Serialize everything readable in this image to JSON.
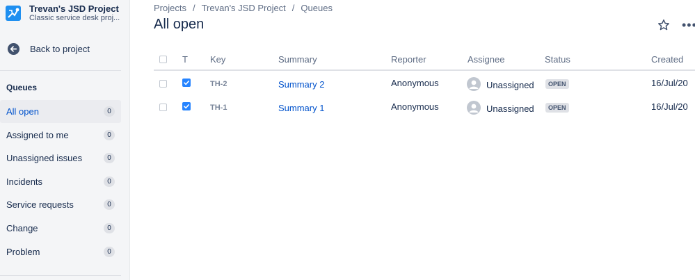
{
  "project": {
    "name": "Trevan's JSD Project",
    "type": "Classic service desk proj..."
  },
  "sidebar": {
    "back_label": "Back to project",
    "queues_heading": "Queues",
    "queues": [
      {
        "label": "All open",
        "count": "0",
        "active": true
      },
      {
        "label": "Assigned to me",
        "count": "0"
      },
      {
        "label": "Unassigned issues",
        "count": "0"
      },
      {
        "label": "Incidents",
        "count": "0"
      },
      {
        "label": "Service requests",
        "count": "0"
      },
      {
        "label": "Change",
        "count": "0"
      },
      {
        "label": "Problem",
        "count": "0"
      }
    ]
  },
  "breadcrumb": {
    "items": [
      "Projects",
      "Trevan's JSD Project",
      "Queues"
    ],
    "separator": "/"
  },
  "page": {
    "title": "All open",
    "more_label": "•••"
  },
  "table": {
    "columns": [
      "T",
      "Key",
      "Summary",
      "Reporter",
      "Assignee",
      "Status",
      "Created"
    ],
    "rows": [
      {
        "key": "TH-2",
        "summary": "Summary 2",
        "reporter": "Anonymous",
        "assignee": "Unassigned",
        "status": "OPEN",
        "created": "16/Jul/20"
      },
      {
        "key": "TH-1",
        "summary": "Summary 1",
        "reporter": "Anonymous",
        "assignee": "Unassigned",
        "status": "OPEN",
        "created": "16/Jul/20"
      }
    ]
  },
  "colors": {
    "link": "#0052cc",
    "sidebar_bg": "#f4f5f7",
    "checkbox_checked": "#2684ff"
  }
}
